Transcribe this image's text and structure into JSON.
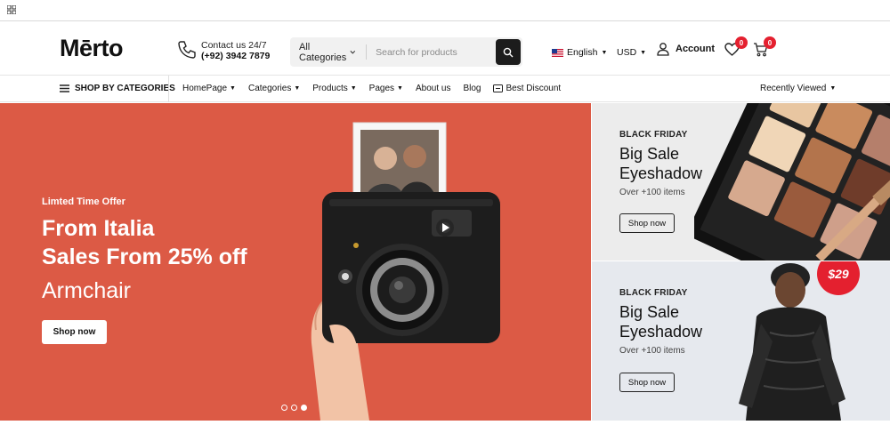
{
  "header": {
    "logo": "Mērto",
    "contact_line1": "Contact us 24/7",
    "contact_line2": "(+92) 3942 7879",
    "search": {
      "category": "All Categories",
      "placeholder": "Search for products"
    },
    "language": "English",
    "currency": "USD",
    "account_label": "Account",
    "wishlist_count": "0",
    "cart_count": "0"
  },
  "nav": {
    "shop_by": "SHOP BY CATEGORIES",
    "links": [
      "HomePage",
      "Categories",
      "Products",
      "Pages",
      "About us",
      "Blog",
      "Best Discount"
    ],
    "recently_viewed": "Recently Viewed"
  },
  "hero": {
    "tag": "Limted Time Offer",
    "line1": "From Italia",
    "line2": "Sales From 25% off",
    "line3": "Armchair",
    "button": "Shop now",
    "bg_color": "#dc5a45"
  },
  "promos": [
    {
      "tag": "BLACK FRIDAY",
      "title1": "Big Sale",
      "title2": "Eyeshadow",
      "sub": "Over +100 items",
      "button": "Shop now"
    },
    {
      "tag": "BLACK FRIDAY",
      "title1": "Big Sale",
      "title2": "Eyeshadow",
      "sub": "Over +100 items",
      "button": "Shop now",
      "price": "$29"
    }
  ],
  "icons": [
    "apps-grid-icon",
    "phone-icon",
    "chevron-down-icon",
    "search-icon",
    "us-flag-icon",
    "user-icon",
    "heart-icon",
    "cart-icon",
    "menu-icon",
    "discount-tag-icon",
    "play-icon"
  ]
}
